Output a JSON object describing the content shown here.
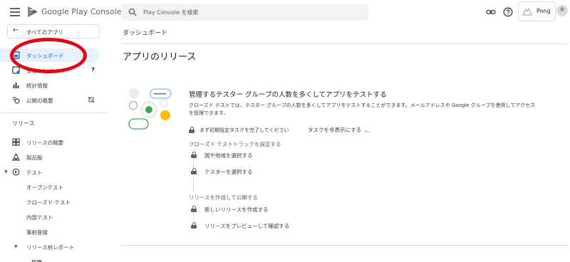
{
  "header": {
    "app_title": "Google Play Console",
    "search_placeholder": "Play Console を検索",
    "account_name": "Pong"
  },
  "sidebar": {
    "back_label": "すべてのアプリ",
    "items": [
      {
        "label": "ダッシュボード",
        "icon": "dashboard-icon",
        "active": true
      },
      {
        "label": "受信トレイ",
        "icon": "inbox-icon",
        "badge": "7"
      },
      {
        "label": "統計情報",
        "icon": "bar-chart-icon"
      },
      {
        "label": "公開の概要",
        "icon": "publishing-overview-icon"
      }
    ],
    "section_label": "リリース",
    "release_items": [
      {
        "label": "リリースの概要",
        "icon": "releases-overview-icon"
      },
      {
        "label": "製品版",
        "icon": "production-icon"
      },
      {
        "label": "テスト",
        "icon": "testing-icon",
        "expanded": true
      },
      {
        "label": "オープンテスト"
      },
      {
        "label": "クローズド テスト"
      },
      {
        "label": "内部テスト"
      },
      {
        "label": "事前登録"
      },
      {
        "label": "リリース前レポート",
        "expanded": true
      },
      {
        "label": "概要"
      }
    ]
  },
  "main": {
    "page_title": "ダッシュボード",
    "section_title": "アプリのリリース",
    "card": {
      "title": "管理するテスター グループの人数を多くしてアプリをテストする",
      "description": "クローズド テストでは、テスター グループの人数を多くしてアプリをテストすることができます。メールアドレスや Google グループを使用してアクセスを管理できます。",
      "task_note": "まず初期設定タスクを完了してください",
      "hide_label": "タスクを非表示にする",
      "groups": [
        {
          "label": "クローズド テストトラックを設定する",
          "steps": [
            "国や地域を選択する",
            "テスターを選択する"
          ]
        },
        {
          "label": "リリースを作成して公開する",
          "steps": [
            "新しいリリースを作成する",
            "リリースをプレビューして確認する"
          ]
        }
      ]
    }
  },
  "colors": {
    "accent": "#1967d2",
    "active_bg": "#e8f0fe",
    "annotation_ring": "#e30613"
  }
}
